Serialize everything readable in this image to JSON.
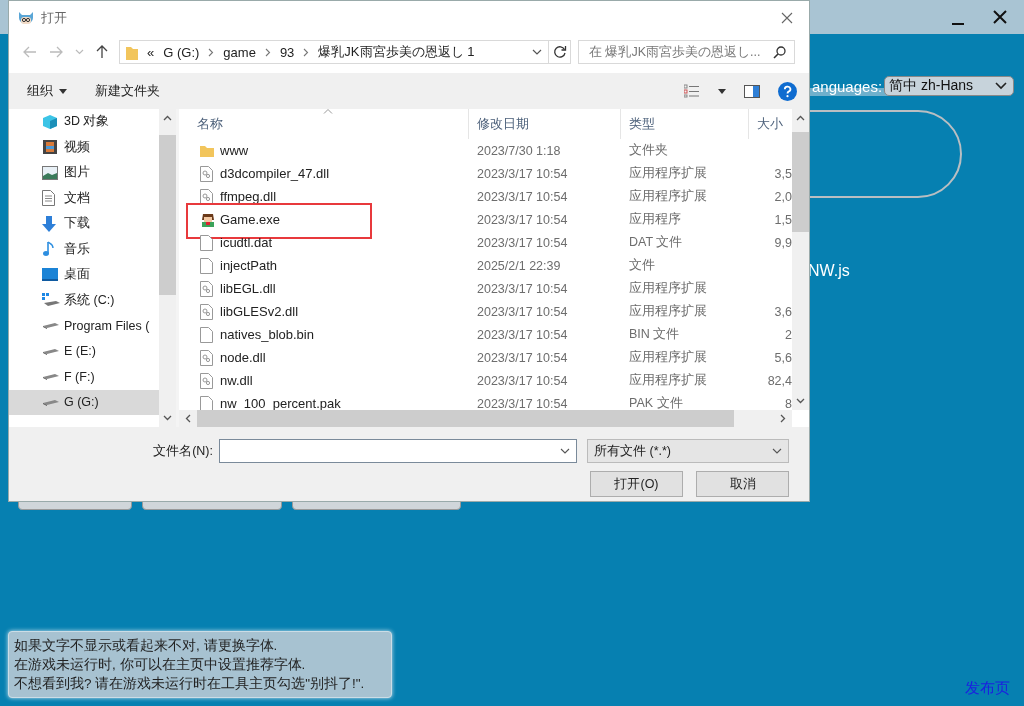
{
  "app": {
    "languages_label": "anguages:",
    "language": "简中 zh-Hans",
    "engine_text": "NW.js",
    "notice": [
      "如果文字不显示或看起来不对, 请更换字体.",
      "在游戏未运行时, 你可以在主页中设置推荐字体.",
      "不想看到我? 请在游戏未运行时在工具主页勾选\"别抖了!\"."
    ],
    "release_link": "发布页"
  },
  "dialog": {
    "title": "打开",
    "breadcrumb": [
      "«",
      "G (G:)",
      "game",
      "93",
      "爆乳JK雨宮歩美の恩返し 1"
    ],
    "search": {
      "placeholder": "在 爆乳JK雨宮歩美の恩返し..."
    },
    "toolbar": [
      "组织",
      "新建文件夹"
    ],
    "sidebar": [
      {
        "label": "3D 对象",
        "kind": "cube",
        "selected": false
      },
      {
        "label": "视频",
        "kind": "video",
        "selected": false
      },
      {
        "label": "图片",
        "kind": "picture",
        "selected": false
      },
      {
        "label": "文档",
        "kind": "document",
        "selected": false
      },
      {
        "label": "下载",
        "kind": "download",
        "selected": false
      },
      {
        "label": "音乐",
        "kind": "music",
        "selected": false
      },
      {
        "label": "桌面",
        "kind": "desktop",
        "selected": false
      },
      {
        "label": "系统 (C:)",
        "kind": "system",
        "selected": false
      },
      {
        "label": "Program Files (",
        "kind": "drive",
        "selected": false
      },
      {
        "label": "E (E:)",
        "kind": "drive",
        "selected": false
      },
      {
        "label": "F (F:)",
        "kind": "drive",
        "selected": false
      },
      {
        "label": "G (G:)",
        "kind": "drive",
        "selected": true
      }
    ],
    "columns": [
      "名称",
      "修改日期",
      "类型",
      "大小"
    ],
    "files": [
      {
        "name": "www",
        "date": "2023/7/30 1:18",
        "type": "文件夹",
        "kind": "folder",
        "highlighted": false
      },
      {
        "name": "d3dcompiler_47.dll",
        "date": "2023/3/17 10:54",
        "type": "应用程序扩展",
        "size": "3,5",
        "kind": "dll",
        "highlighted": false
      },
      {
        "name": "ffmpeg.dll",
        "date": "2023/3/17 10:54",
        "type": "应用程序扩展",
        "size": "2,0",
        "kind": "dll",
        "highlighted": false
      },
      {
        "name": "Game.exe",
        "date": "2023/3/17 10:54",
        "type": "应用程序",
        "size": "1,5",
        "kind": "exe",
        "highlighted": true
      },
      {
        "name": "icudtl.dat",
        "date": "2023/3/17 10:54",
        "type": "DAT 文件",
        "size": "9,9",
        "kind": "file",
        "highlighted": false
      },
      {
        "name": "injectPath",
        "date": "2025/2/1 22:39",
        "type": "文件",
        "kind": "file",
        "highlighted": false
      },
      {
        "name": "libEGL.dll",
        "date": "2023/3/17 10:54",
        "type": "应用程序扩展",
        "kind": "dll",
        "highlighted": false
      },
      {
        "name": "libGLESv2.dll",
        "date": "2023/3/17 10:54",
        "type": "应用程序扩展",
        "size": "3,6",
        "kind": "dll",
        "highlighted": false
      },
      {
        "name": "natives_blob.bin",
        "date": "2023/3/17 10:54",
        "type": "BIN 文件",
        "size": "2",
        "kind": "file",
        "highlighted": false
      },
      {
        "name": "node.dll",
        "date": "2023/3/17 10:54",
        "type": "应用程序扩展",
        "size": "5,6",
        "kind": "dll",
        "highlighted": false
      },
      {
        "name": "nw.dll",
        "date": "2023/3/17 10:54",
        "type": "应用程序扩展",
        "size": "82,4",
        "kind": "dll",
        "highlighted": false
      },
      {
        "name": "nw_100_percent.pak",
        "date": "2023/3/17 10:54",
        "type": "PAK 文件",
        "size": "8",
        "kind": "file",
        "highlighted": false
      }
    ],
    "filename_label": "文件名(N):",
    "filter": "所有文件 (*.*)",
    "buttons": [
      "打开(O)",
      "取消"
    ]
  }
}
